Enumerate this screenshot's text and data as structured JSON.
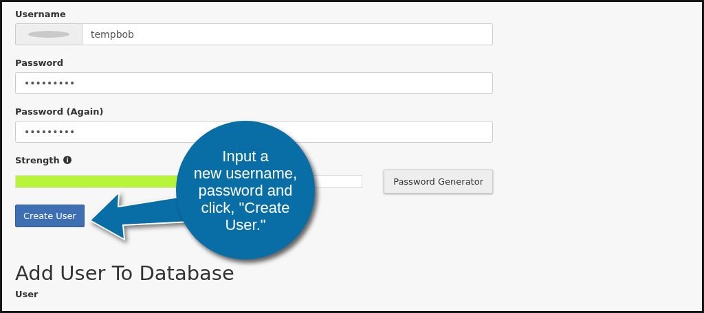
{
  "form": {
    "username": {
      "label": "Username",
      "prefix_redacted": true,
      "value": "tempbob"
    },
    "password": {
      "label": "Password",
      "value": "•••••••••"
    },
    "password_again": {
      "label": "Password (Again)",
      "value": "•••••••••"
    },
    "strength": {
      "label": "Strength",
      "level": 0.75
    },
    "password_generator_button": "Password Generator",
    "create_user_button": "Create User"
  },
  "section": {
    "heading": "Add User To Database",
    "field_label": "User"
  },
  "callout": {
    "lines": [
      "Input a",
      "new username,",
      "password and",
      "click, \"Create",
      "User.\""
    ]
  }
}
